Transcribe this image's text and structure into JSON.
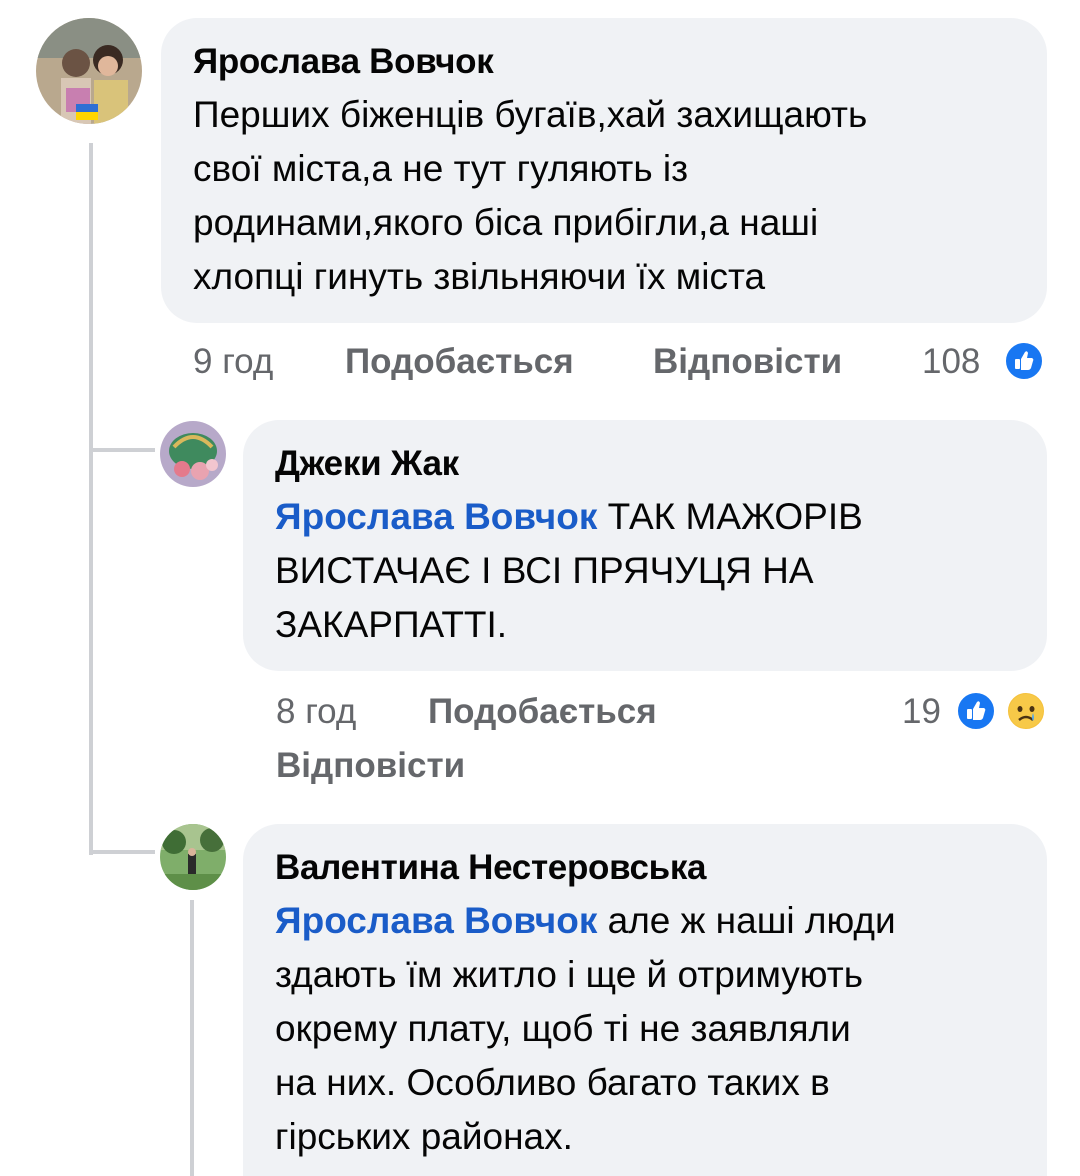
{
  "comments": [
    {
      "author": "Ярослава Вовчок",
      "lines": [
        "Перших біженців бугаїв,хай захищають",
        "свої міста,а не тут гуляють із",
        "родинами,якого біса прибігли,а наші",
        "хлопці гинуть звільняючи їх міста"
      ],
      "time": "9 год",
      "like_label": "Подобається",
      "reply_label": "Відповісти",
      "reaction_count": "108"
    },
    {
      "author": "Джеки Жак",
      "mention": "Ярослава Вовчок",
      "line1_rest": " ТАК МАЖОРІВ",
      "lines": [
        "ВИСТАЧАЄ І ВСІ ПРЯЧУЦЯ НА",
        "ЗАКАРПАТТІ."
      ],
      "time": "8 год",
      "like_label": "Подобається",
      "reply_label": "Відповісти",
      "reaction_count": "19"
    },
    {
      "author": "Валентина Нестеровська",
      "mention": "Ярослава Вовчок",
      "line1_rest": " але ж наші люди",
      "lines": [
        "здають їм житло і ще й отримують",
        "окрему плату, щоб ті не заявляли",
        "на них. Особливо багато таких в",
        "гірських районах."
      ]
    }
  ],
  "colors": {
    "bubble": "#f0f2f5",
    "mention": "#1a5cc8",
    "meta": "#65676b",
    "like_blue": "#1877f2"
  },
  "icons": {
    "like_reaction": "thumbs-up-icon",
    "sad_reaction": "sad-face-icon"
  }
}
